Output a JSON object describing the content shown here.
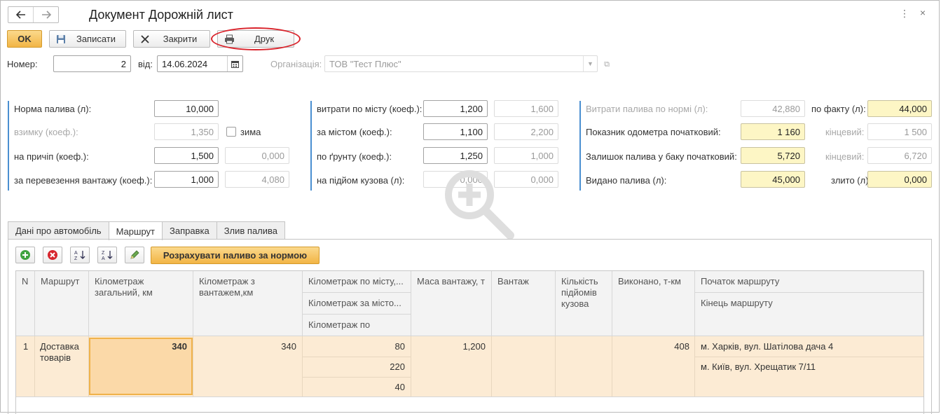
{
  "window": {
    "title": "Документ Дорожній лист",
    "menu_glyph": "⋮",
    "close_glyph": "×"
  },
  "toolbar": {
    "ok_label": "OK",
    "save_label": "Записати",
    "close_label": "Закрити",
    "print_label": "Друк"
  },
  "header": {
    "number_label": "Номер:",
    "number_value": "2",
    "date_label": "від:",
    "date_value": "14.06.2024",
    "org_label": "Організація:",
    "org_value": "ТОВ \"Тест Плюс\""
  },
  "norms": {
    "fuel_norm_label": "Норма палива (л):",
    "fuel_norm_value": "10,000",
    "winter_label": "взимку (коеф.):",
    "winter_value": "1,350",
    "winter_checkbox_label": "зима",
    "trailer_label": "на причіп (коеф.):",
    "trailer_value": "1,500",
    "trailer_value2": "0,000",
    "cargo_label": "за перевезення вантажу (коеф.):",
    "cargo_value": "1,000",
    "cargo_value2": "4,080"
  },
  "coefficients": {
    "city_label": "витрати по місту (коеф.):",
    "city_value": "1,200",
    "city_value2": "1,600",
    "outcity_label": "за містом (коеф.):",
    "outcity_value": "1,100",
    "outcity_value2": "2,200",
    "ground_label": "по ґрунту (коеф.):",
    "ground_value": "1,250",
    "ground_value2": "1,000",
    "lift_label": "на підйом кузова (л):",
    "lift_value": "0,000",
    "lift_value2": "0,000"
  },
  "totals": {
    "norm_consumption_label": "Витрати палива по нормі (л):",
    "norm_consumption_value": "42,880",
    "fact_label": "по факту (л):",
    "fact_value": "44,000",
    "odometer_start_label": "Показник одометра початковий:",
    "odometer_start_value": "1 160",
    "odometer_end_label": "кінцевий:",
    "odometer_end_value": "1 500",
    "tank_start_label": "Залишок палива у баку початковий:",
    "tank_start_value": "5,720",
    "tank_end_label": "кінцевий:",
    "tank_end_value": "6,720",
    "issued_label": "Видано палива (л):",
    "issued_value": "45,000",
    "drained_label": "злито (л):",
    "drained_value": "0,000"
  },
  "tabs": [
    {
      "label": "Дані про автомобіль"
    },
    {
      "label": "Маршрут"
    },
    {
      "label": "Заправка"
    },
    {
      "label": "Злив палива"
    }
  ],
  "table_toolbar": {
    "calc_label": "Розрахувати паливо за нормою"
  },
  "grid": {
    "headers": {
      "n": "N",
      "route": "Маршрут",
      "km_total": "Кілометраж загальний, км",
      "km_cargo": "Кілометраж з вантажем,км",
      "km_city": "Кілометраж по місту,...",
      "km_outcity": "Кілометраж за місто...",
      "km_ground": "Кілометраж по",
      "cargo_mass": "Маса вантажу, т",
      "cargo": "Вантаж",
      "lifts": "Кількість підйомів кузова",
      "done": "Виконано, т-км",
      "route_start": "Початок маршруту",
      "route_end": "Кінець маршруту"
    },
    "rows": [
      {
        "n": "1",
        "route": "Доставка товарів",
        "km_total": "340",
        "km_cargo": "340",
        "km_city": "80",
        "km_outcity": "220",
        "km_ground": "40",
        "cargo_mass": "1,200",
        "cargo": "",
        "lifts": "",
        "done": "408",
        "route_start": "м. Харків, вул. Шатілова дача 4",
        "route_end": "м. Київ, вул. Хрещатик 7/11"
      }
    ]
  },
  "colors": {
    "accent_button": "#f2b545",
    "highlight_field": "#fdf6c5",
    "selected_row": "#fcebd4",
    "annotation_ring": "#d9242c",
    "group_bar": "#4a8fd1"
  }
}
